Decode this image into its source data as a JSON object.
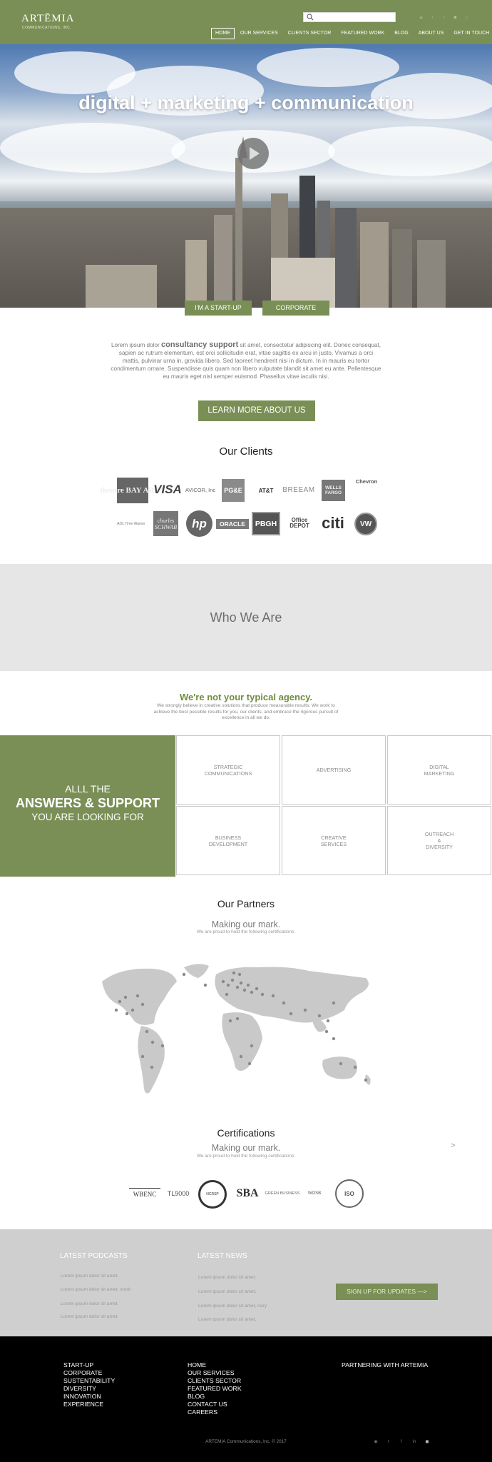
{
  "header": {
    "logo_text": "ARTĒMIA",
    "logo_subtext": "COMMUNICATIONS, INC.",
    "search_placeholder": "",
    "nav": [
      {
        "label": "HOME",
        "active": true
      },
      {
        "label": "OUR SERVICES"
      },
      {
        "label": "CLIENTS SECTOR"
      },
      {
        "label": "FEATURED WORK"
      },
      {
        "label": "BLOG"
      },
      {
        "label": "ABOUT US"
      },
      {
        "label": "GET IN TOUCH"
      }
    ],
    "social_icons": [
      "rss-icon",
      "twitter-icon",
      "facebook-icon",
      "linkedin-icon",
      "instagram-icon"
    ]
  },
  "hero": {
    "title": "digital + marketing + communication",
    "buttons": [
      "I'M A START-UP",
      "CORPORATE"
    ]
  },
  "intro": {
    "lead": "Lorem ipsum dolor",
    "strong": "consultancy support",
    "rest": "sit amet, consectetur adipiscing elit. Donec consequat, sapien ac rutrum elementum, est orci sollicitudin erat, vitae sagittis ex arcu in justo. Vivamus a orci mattis, pulvinar urna in, gravida libero. Sed laoreet hendrerit nisi in dictum. In in mauris eu tortor condimentum ornare. Suspendisse quis quam non libero vulputate blandit sit amet eu ante. Pellentesque eu mauris eget nisl semper euismod. Phasellus vitae iaculis nisi.",
    "button": "LEARN MORE ABOUT US"
  },
  "clients": {
    "title": "Our Clients",
    "logos": [
      "theatre BAY AREA",
      "VISA",
      "AVICOR, Inc",
      "PG&E",
      "AT&T",
      "BREEAM",
      "WELLS FARGO",
      "Chevron",
      "AOL Time Warner",
      "charles SCHWAB",
      "hp",
      "ORACLE",
      "PBGH",
      "Office DEPOT",
      "citi",
      "VW"
    ]
  },
  "who": {
    "title": "Who We Are"
  },
  "agency": {
    "title": "We're not your typical agency.",
    "text": "We strongly believe in creative solutions that produce measurable results. We work to achieve the best possible results for you, our clients, and embrace the rigorous pursuit of excellence in all we do."
  },
  "answers": {
    "line1": "ALLL THE",
    "line2": "ANSWERS & SUPPORT",
    "line3": "YOU ARE LOOKING FOR"
  },
  "services": [
    "STRATEGIC\nCOMMUNICATIONS",
    "ADVERTISING",
    "DIGITAL\nMARKETING",
    "BUSINESS\nDEVELOPMENT",
    "CREATIVE\nSERVICES",
    "OUTREACH\n&\nDIVERSITY"
  ],
  "partners": {
    "title": "Our Partners",
    "subtitle": "Making our mark.",
    "note": "We are proud to hold the following certifications:"
  },
  "certifications": {
    "title": "Certifications",
    "subtitle": "Making our mark.",
    "note": "We are proud to hold the following certifications:",
    "next": ">",
    "logos": [
      "WBENC",
      "TL9000",
      "NCRSP",
      "SBA",
      "GREEN BUSINESS",
      "WOSB",
      "ISO"
    ]
  },
  "podcasts": {
    "title": "LATEST PODCASTS",
    "items": [
      "Lorem ipsum dolor sit amet.",
      "Lorem ipsum dolor sit amet, morb",
      "Lorem ipsum dolor sit amet.",
      "Lorem ipsum dolor sit amet."
    ]
  },
  "news": {
    "title": "LATEST NEWS",
    "items": [
      "Lorem ipsum dolor sit amet.",
      "Lorem ipsum dolor sit amet.",
      "Lorem ipsum dolor sit amet, nary",
      "Lorem ipsum dolor sit amet."
    ]
  },
  "signup": {
    "button": "SIGN UP FOR UPDATES  —>"
  },
  "footer": {
    "col1": [
      "START-UP",
      "CORPORATE",
      "SUSTENTABILITY",
      "DIVERSITY",
      "INNOVATION",
      "EXPERIENCE"
    ],
    "col2": [
      "HOME",
      "OUR SERVICES",
      "CLIENTS SECTOR",
      "FEATURED WORK",
      "BLOG",
      "CONTACT US",
      "CAREERS"
    ],
    "partnering": "PARTNERING WITH ARTEMIA",
    "copyright": "ARTEMIA Communications, Inc. © 2017",
    "social_icons": [
      "rss-icon",
      "twitter-icon",
      "facebook-icon",
      "linkedin-icon",
      "instagram-icon"
    ]
  },
  "colors": {
    "brand_green": "#7a8f55",
    "agency_green": "#6f8d3f",
    "footer_black": "#000000"
  }
}
